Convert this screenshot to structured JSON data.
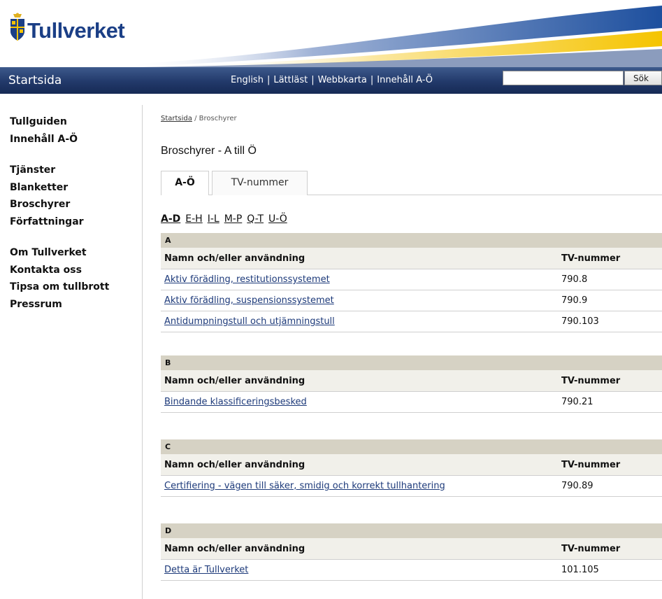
{
  "header": {
    "logo_text": "Tullverket",
    "logo_icon": "coat-of-arms-icon",
    "accent_colors": {
      "blue": "#1b3f86",
      "yellow": "#f5c400",
      "navbar": "#22396a"
    }
  },
  "navbar": {
    "home_label": "Startsida",
    "links": {
      "english": "English",
      "lattlast": "Lättläst",
      "webbkarta": "Webbkarta",
      "innehall": "Innehåll A-Ö"
    },
    "separator": "|",
    "search": {
      "value": "",
      "placeholder": "",
      "button_label": "Sök"
    }
  },
  "sidebar": {
    "group1": [
      "Tullguiden",
      "Innehåll A-Ö"
    ],
    "group2": [
      "Tjänster",
      "Blanketter",
      "Broschyrer",
      "Författningar"
    ],
    "group3": [
      "Om Tullverket",
      "Kontakta oss",
      "Tipsa om tullbrott",
      "Pressrum"
    ]
  },
  "main": {
    "breadcrumb": {
      "home": "Startsida",
      "separator": " / ",
      "current": "Broschyrer"
    },
    "title": "Broschyrer - A till Ö",
    "tabs": [
      "A-Ö",
      "TV-nummer"
    ],
    "letter_nav": [
      "A-D",
      "E-H",
      "I-L",
      "M-P",
      "Q-T",
      "U-Ö"
    ],
    "columns": {
      "name": "Namn och/eller användning",
      "number": "TV-nummer"
    },
    "sections": [
      {
        "letter": "A",
        "rows": [
          {
            "name": "Aktiv förädling, restitutionssystemet",
            "number": "790.8"
          },
          {
            "name": "Aktiv förädling, suspensionssystemet",
            "number": "790.9"
          },
          {
            "name": "Antidumpningstull och utjämningstull",
            "number": "790.103"
          }
        ]
      },
      {
        "letter": "B",
        "rows": [
          {
            "name": "Bindande klassificeringsbesked",
            "number": "790.21"
          }
        ]
      },
      {
        "letter": "C",
        "rows": [
          {
            "name": "Certifiering - vägen till säker, smidig och korrekt tullhantering",
            "number": "790.89"
          }
        ]
      },
      {
        "letter": "D",
        "rows": [
          {
            "name": "Detta är Tullverket",
            "number": "101.105"
          }
        ]
      }
    ]
  }
}
